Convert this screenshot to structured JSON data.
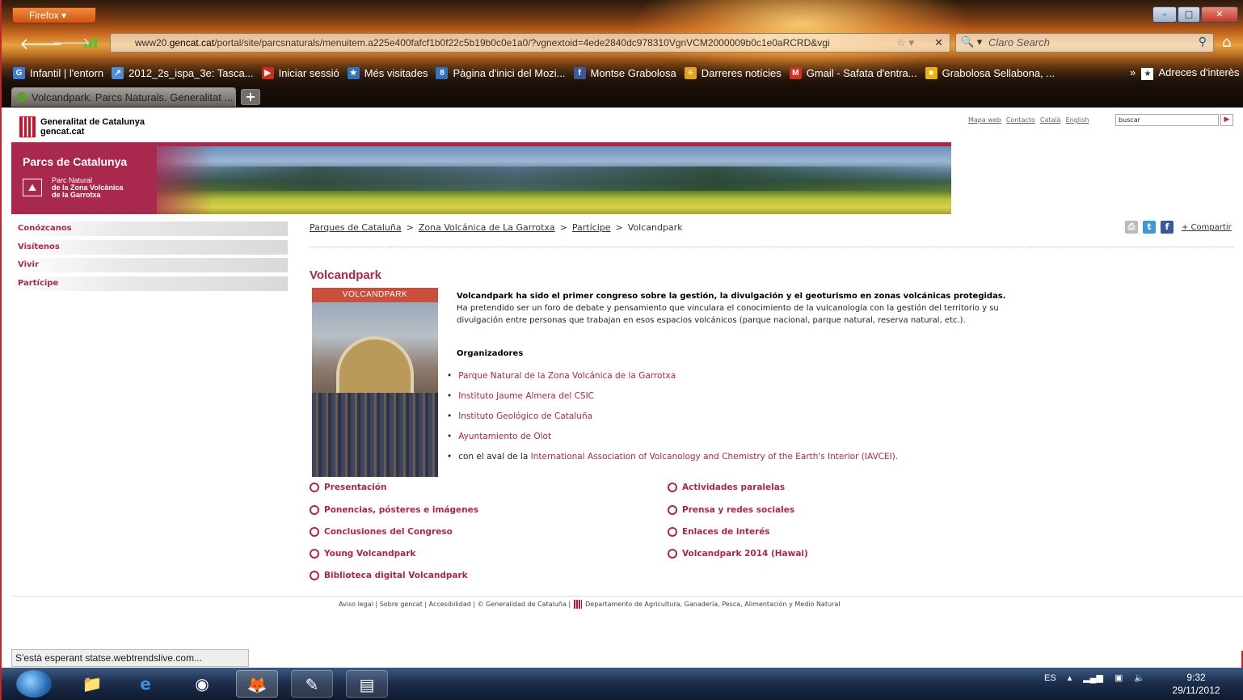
{
  "browser": {
    "menu_button": "Firefox",
    "url_domain_prefix": "www20.",
    "url_domain": "gencat.cat",
    "url_path": "/portal/site/parcsnaturals/menuitem.a225e400fafcf1b0f22c5b19b0c0e1a0/?vgnextoid=4ede2840dc978310VgnVCM2000009b0c1e0aRCRD&vgi",
    "search_placeholder": "Claro Search",
    "bookmarks": [
      {
        "icon": "G",
        "color": "#3b7dd8",
        "label": "Infantil | l'entorn"
      },
      {
        "icon": "↗",
        "color": "#4a90d9",
        "label": "2012_2s_ispa_3e: Tasca..."
      },
      {
        "icon": "▶",
        "color": "#d12b1e",
        "label": "Iniciar sessió"
      },
      {
        "icon": "★",
        "color": "#2f74c0",
        "label": "Més visitades"
      },
      {
        "icon": "8",
        "color": "#2f74c0",
        "label": "Pàgina d'inici del Mozi..."
      },
      {
        "icon": "f",
        "color": "#3b5998",
        "label": "Montse Grabolosa"
      },
      {
        "icon": "≡",
        "color": "#e3a21a",
        "label": "Darreres notícies"
      },
      {
        "icon": "M",
        "color": "#d93025",
        "label": "Gmail - Safata d'entra..."
      },
      {
        "icon": "■",
        "color": "#f0b400",
        "label": "Grabolosa Sellabona, ..."
      }
    ],
    "bookmarks_more": "»",
    "bookmarks_folder": "Adreces d'interès",
    "tab_title": "Volcandpark. Parcs Naturals. Generalitat ...",
    "newtab_label": "+",
    "status_text": "S'està esperant statse.webtrendslive.com..."
  },
  "site": {
    "org_line1": "Generalitat de Catalunya",
    "org_line2": "gencat.cat",
    "top_links": [
      "Mapa web",
      "Contacto",
      "Català",
      "English"
    ],
    "search_value": "buscar",
    "banner_title": "Parcs de Catalunya",
    "park_line1": "Parc Natural",
    "park_line2": "de la Zona Volcànica",
    "park_line3": "de la Garrotxa"
  },
  "sidenav": [
    "Conózcanos",
    "Visítenos",
    "Vivir",
    "Partícipe"
  ],
  "breadcrumb": [
    "Parques de Cataluña",
    "Zona Volcánica de La Garrotxa",
    "Partícipe",
    "Volcandpark"
  ],
  "share_label": "+ Compartir",
  "page": {
    "title": "Volcandpark",
    "poster_title": "VOLCANDPARK",
    "intro_bold": "Volcandpark ha sido el primer congreso sobre la gestión, la divulgación y el geoturismo en zonas volcánicas protegidas.",
    "intro_text": "Ha pretendido ser un foro de debate y pensamiento que vinculara el conocimiento de la vulcanología con la gestión del territorio y su divulgación entre personas que trabajan en esos espacios volcánicos (parque nacional, parque natural, reserva natural, etc.).",
    "organizers_label": "Organizadores",
    "organizers": [
      "Parque Natural de la Zona Volcánica de la Garrotxa",
      "Instituto Jaume Almera del CSIC",
      "Instituto Geológico de Cataluña",
      "Ayuntamiento de Olot"
    ],
    "endorsement_prefix": "con el aval de la ",
    "endorsement_link": "International Association of Volcanology and Chemistry of the Earth's Interior (IAVCEI).",
    "links_left": [
      "Presentación",
      "Ponencias, pósteres e imágenes",
      "Conclusiones del Congreso",
      "Young Volcandpark",
      "Biblioteca digital Volcandpark"
    ],
    "links_right": [
      "Actividades paralelas",
      "Prensa y redes sociales",
      "Enlaces de interés",
      "Volcandpark 2014 (Hawai)"
    ]
  },
  "footer": {
    "text": "Aviso legal | Sobre gencat | Accesibilidad | © Generalidad de Cataluña |",
    "dept": "Departamento de Agricultura, Ganadería, Pesca, Alimentación y Medio Natural"
  },
  "taskbar": {
    "lang": "ES",
    "time": "9:32",
    "date": "29/11/2012"
  }
}
